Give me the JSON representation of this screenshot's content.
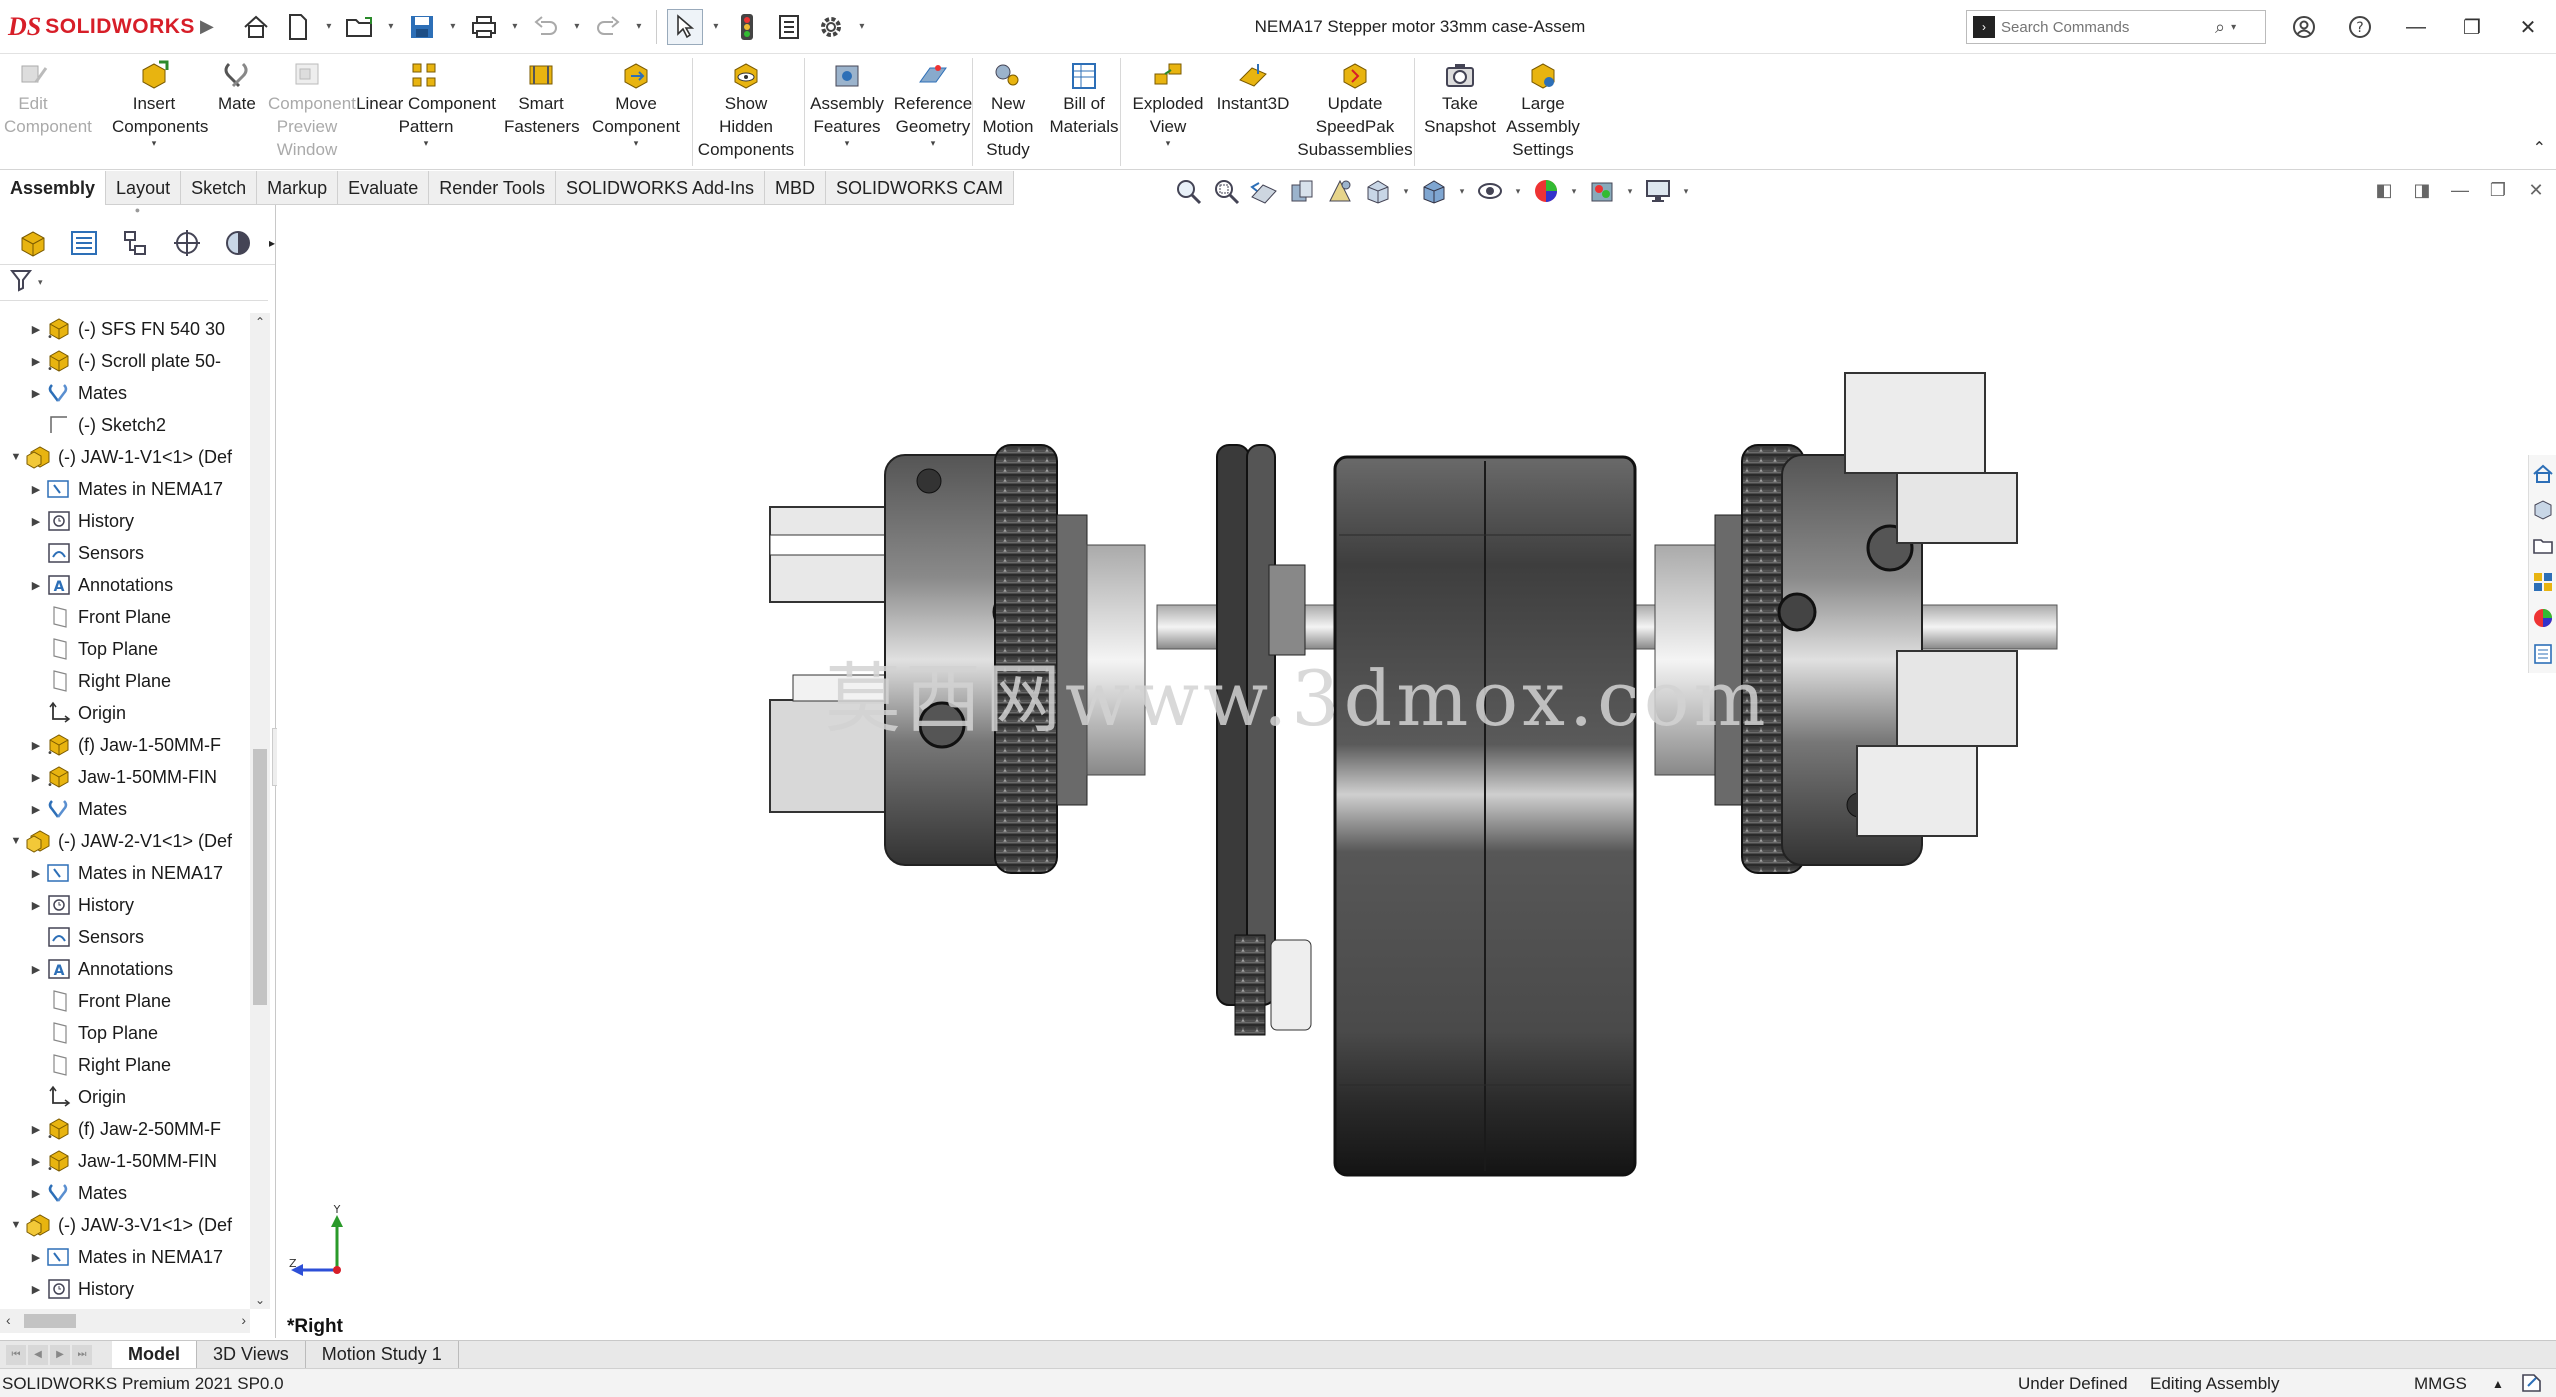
{
  "app": {
    "logo_prefix": "DS",
    "logo_name": "SOLIDWORKS",
    "document_title": "NEMA17 Stepper motor 33mm case-Assem"
  },
  "search": {
    "placeholder": "Search Commands"
  },
  "command_manager": [
    {
      "id": "edit-component",
      "label": "Edit\nComponent",
      "disabled": true,
      "icon": "edit-component-icon"
    },
    {
      "id": "insert-components",
      "label": "Insert\nComponents",
      "disabled": false,
      "icon": "insert-components-icon"
    },
    {
      "id": "mate",
      "label": "Mate",
      "disabled": false,
      "icon": "mate-icon"
    },
    {
      "id": "component-preview-window",
      "label": "Component\nPreview\nWindow",
      "disabled": true,
      "icon": "component-preview-icon"
    },
    {
      "id": "linear-component-pattern",
      "label": "Linear Component\nPattern",
      "disabled": false,
      "icon": "linear-pattern-icon"
    },
    {
      "id": "smart-fasteners",
      "label": "Smart\nFasteners",
      "disabled": false,
      "icon": "smart-fasteners-icon"
    },
    {
      "id": "move-component",
      "label": "Move\nComponent",
      "disabled": false,
      "icon": "move-component-icon"
    },
    {
      "id": "show-hidden-components",
      "label": "Show\nHidden\nComponents",
      "disabled": false,
      "icon": "show-hidden-icon"
    },
    {
      "id": "assembly-features",
      "label": "Assembly\nFeatures",
      "disabled": false,
      "icon": "assembly-features-icon"
    },
    {
      "id": "reference-geometry",
      "label": "Reference\nGeometry",
      "disabled": false,
      "icon": "reference-geometry-icon"
    },
    {
      "id": "new-motion-study",
      "label": "New\nMotion\nStudy",
      "disabled": false,
      "icon": "motion-study-icon"
    },
    {
      "id": "bill-of-materials",
      "label": "Bill of\nMaterials",
      "disabled": false,
      "icon": "bom-icon"
    },
    {
      "id": "exploded-view",
      "label": "Exploded\nView",
      "disabled": false,
      "icon": "exploded-view-icon"
    },
    {
      "id": "instant3d",
      "label": "Instant3D",
      "disabled": false,
      "icon": "instant3d-icon"
    },
    {
      "id": "update-speedpak",
      "label": "Update\nSpeedPak\nSubassemblies",
      "disabled": false,
      "icon": "speedpak-icon"
    },
    {
      "id": "take-snapshot",
      "label": "Take\nSnapshot",
      "disabled": false,
      "icon": "snapshot-icon"
    },
    {
      "id": "large-assembly-settings",
      "label": "Large\nAssembly\nSettings",
      "disabled": false,
      "icon": "large-assembly-icon"
    }
  ],
  "tabs": [
    "Assembly",
    "Layout",
    "Sketch",
    "Markup",
    "Evaluate",
    "Render Tools",
    "SOLIDWORKS Add-Ins",
    "MBD",
    "SOLIDWORKS CAM"
  ],
  "active_tab": "Assembly",
  "tree": [
    {
      "level": 2,
      "expand": "▶",
      "icon": "part-icon",
      "label": "(-) SFS FN 540 30"
    },
    {
      "level": 2,
      "expand": "▶",
      "icon": "part-icon",
      "label": "(-) Scroll plate 50-"
    },
    {
      "level": 2,
      "expand": "▶",
      "icon": "mates-icon",
      "label": "Mates"
    },
    {
      "level": 2,
      "expand": "",
      "icon": "sketch-icon",
      "label": "(-) Sketch2"
    },
    {
      "level": 1,
      "expand": "▼",
      "icon": "subassembly-icon",
      "label": "(-) JAW-1-V1<1> (Def"
    },
    {
      "level": 2,
      "expand": "▶",
      "icon": "mates-folder-icon",
      "label": "Mates in NEMA17"
    },
    {
      "level": 2,
      "expand": "▶",
      "icon": "history-icon",
      "label": "History"
    },
    {
      "level": 2,
      "expand": "",
      "icon": "sensors-icon",
      "label": "Sensors"
    },
    {
      "level": 2,
      "expand": "▶",
      "icon": "annotations-icon",
      "label": "Annotations"
    },
    {
      "level": 2,
      "expand": "",
      "icon": "plane-icon",
      "label": "Front Plane"
    },
    {
      "level": 2,
      "expand": "",
      "icon": "plane-icon",
      "label": "Top Plane"
    },
    {
      "level": 2,
      "expand": "",
      "icon": "plane-icon",
      "label": "Right Plane"
    },
    {
      "level": 2,
      "expand": "",
      "icon": "origin-icon",
      "label": "Origin"
    },
    {
      "level": 2,
      "expand": "▶",
      "icon": "part-icon",
      "label": "(f) Jaw-1-50MM-F"
    },
    {
      "level": 2,
      "expand": "▶",
      "icon": "part-icon",
      "label": "Jaw-1-50MM-FIN"
    },
    {
      "level": 2,
      "expand": "▶",
      "icon": "mates-icon",
      "label": "Mates"
    },
    {
      "level": 1,
      "expand": "▼",
      "icon": "subassembly-icon",
      "label": "(-) JAW-2-V1<1> (Def"
    },
    {
      "level": 2,
      "expand": "▶",
      "icon": "mates-folder-icon",
      "label": "Mates in NEMA17"
    },
    {
      "level": 2,
      "expand": "▶",
      "icon": "history-icon",
      "label": "History"
    },
    {
      "level": 2,
      "expand": "",
      "icon": "sensors-icon",
      "label": "Sensors"
    },
    {
      "level": 2,
      "expand": "▶",
      "icon": "annotations-icon",
      "label": "Annotations"
    },
    {
      "level": 2,
      "expand": "",
      "icon": "plane-icon",
      "label": "Front Plane"
    },
    {
      "level": 2,
      "expand": "",
      "icon": "plane-icon",
      "label": "Top Plane"
    },
    {
      "level": 2,
      "expand": "",
      "icon": "plane-icon",
      "label": "Right Plane"
    },
    {
      "level": 2,
      "expand": "",
      "icon": "origin-icon",
      "label": "Origin"
    },
    {
      "level": 2,
      "expand": "▶",
      "icon": "part-icon",
      "label": "(f) Jaw-2-50MM-F"
    },
    {
      "level": 2,
      "expand": "▶",
      "icon": "part-icon",
      "label": "Jaw-1-50MM-FIN"
    },
    {
      "level": 2,
      "expand": "▶",
      "icon": "mates-icon",
      "label": "Mates"
    },
    {
      "level": 1,
      "expand": "▼",
      "icon": "subassembly-icon",
      "label": "(-) JAW-3-V1<1> (Def"
    },
    {
      "level": 2,
      "expand": "▶",
      "icon": "mates-folder-icon",
      "label": "Mates in NEMA17"
    },
    {
      "level": 2,
      "expand": "▶",
      "icon": "history-icon",
      "label": "History"
    }
  ],
  "graphics": {
    "view_name": "*Right",
    "watermark": "莫西网www.3dmox.com",
    "triad_y": "Y",
    "triad_z": "Z"
  },
  "bottom_tabs": [
    "Model",
    "3D Views",
    "Motion Study 1"
  ],
  "active_bottom_tab": "Model",
  "status": {
    "product": "SOLIDWORKS Premium 2021 SP0.0",
    "definition": "Under Defined",
    "mode": "Editing Assembly",
    "units": "MMGS",
    "units_arrow": "▲"
  },
  "colors": {
    "brand": "#d71e28",
    "icon_yellow": "#e8b410",
    "icon_blue": "#2d6fb7",
    "model_dark": "#4a4a4a",
    "model_light": "#c9c9c9"
  }
}
